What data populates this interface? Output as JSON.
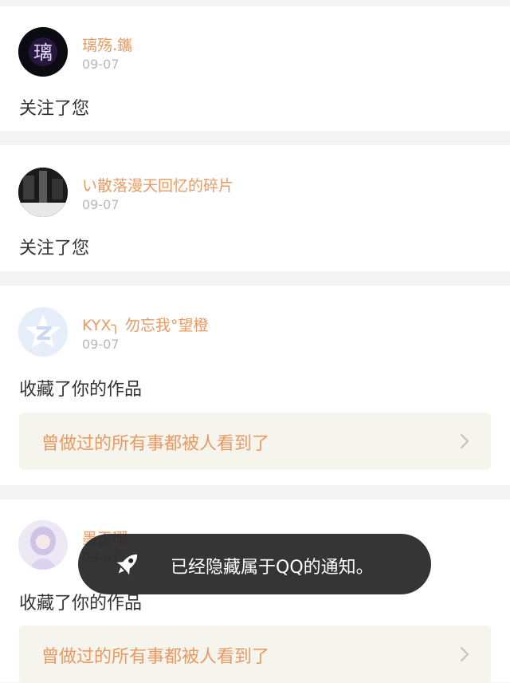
{
  "notifications": [
    {
      "username": "璃殇.鑴",
      "date": "09-07",
      "action": "关注了您",
      "avatar": "purple-glyph-avatar"
    },
    {
      "username": "い散落漫天回忆的碎片",
      "date": "09-07",
      "action": "关注了您",
      "avatar": "dark-photo-avatar"
    },
    {
      "username": "KYX╮ 勿忘我°望橙",
      "date": "09-07",
      "action": "收藏了你的作品",
      "avatar": "default-qzone-avatar",
      "work_title": "曾做过的所有事都被人看到了"
    },
    {
      "username": "墨玉琊",
      "date": "09-07",
      "action": "收藏了你的作品",
      "avatar": "anime-girl-avatar",
      "work_title": "曾做过的所有事都被人看到了"
    }
  ],
  "toast": {
    "message": "已经隐藏属于QQ的通知。",
    "icon": "rocket-icon"
  },
  "colors": {
    "username": "#e89a62",
    "date": "#b7b7b7",
    "action": "#333333",
    "card_bg": "#ffffff",
    "page_bg": "#f4f4f4",
    "work_bg": "#f5f4ed",
    "toast_bg": "#262626"
  }
}
